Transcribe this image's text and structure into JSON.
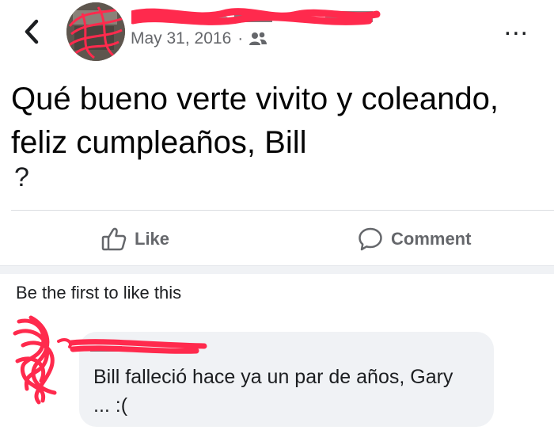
{
  "header": {
    "back_icon": "chevron-left-icon",
    "author_name": "",
    "date": "May 31, 2016",
    "separator": "·",
    "audience_icon": "friends-icon",
    "more_label": "..."
  },
  "post": {
    "text_line1": "Qué bueno verte vivito y coleando,",
    "text_line2": "feliz cumpleaños, Bill",
    "emoji": "?"
  },
  "actions": {
    "like_label": "Like",
    "like_icon": "thumbs-up-icon",
    "comment_label": "Comment",
    "comment_icon": "speech-bubble-icon"
  },
  "reactions": {
    "summary": "Be the first to like this"
  },
  "comment": {
    "text_line1": "Bill falleció hace ya un par de años, Gary",
    "text_line2": "... :("
  },
  "colors": {
    "redaction": "#ff2a4d",
    "secondary_text": "#65676b",
    "bubble": "#f0f2f5"
  }
}
